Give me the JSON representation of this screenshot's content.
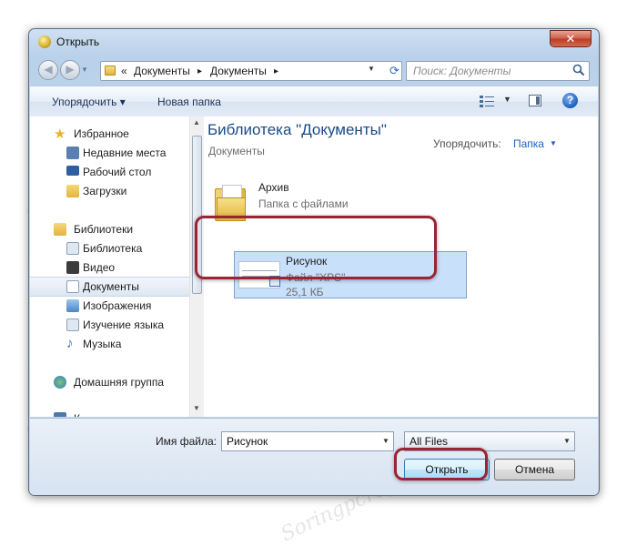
{
  "window": {
    "title": "Открыть",
    "close_glyph": "✕"
  },
  "nav": {
    "back_glyph": "◀",
    "forward_glyph": "▶",
    "breadcrumb": [
      "«",
      "Документы",
      "▸",
      "Документы",
      "▸"
    ],
    "search_placeholder": "Поиск: Документы"
  },
  "toolbar": {
    "organize_label": "Упорядочить ▾",
    "new_folder_label": "Новая папка",
    "help_glyph": "?"
  },
  "sidebar": {
    "items": [
      {
        "label": "Избранное",
        "icon": "star-icon",
        "color": "#e8b32a"
      },
      {
        "label": "Недавние места",
        "icon": "recent-places-icon",
        "color": "#5a7fb3"
      },
      {
        "label": "Рабочий стол",
        "icon": "desktop-icon",
        "color": "#2e5f9e"
      },
      {
        "label": "Загрузки",
        "icon": "downloads-icon",
        "color": "#3d79c9"
      },
      {
        "label": "Библиотеки",
        "icon": "libraries-icon",
        "color": "#e7c35a"
      },
      {
        "label": "Библиотека",
        "icon": "library-icon",
        "color": "#b8c9dc"
      },
      {
        "label": "Видео",
        "icon": "video-icon",
        "color": "#3b3b3b"
      },
      {
        "label": "Документы",
        "icon": "documents-icon",
        "color": "#ffffff"
      },
      {
        "label": "Изображения",
        "icon": "pictures-icon",
        "color": "#4a87c7"
      },
      {
        "label": "Изучение языка",
        "icon": "language-icon",
        "color": "#6a9ad1"
      },
      {
        "label": "Музыка",
        "icon": "music-icon",
        "color": "#2d70c8"
      },
      {
        "label": "Домашняя группа",
        "icon": "homegroup-icon",
        "color": "#3e8e3e"
      },
      {
        "label": "К",
        "icon": "computer-icon",
        "color": "#4d78ab"
      }
    ]
  },
  "content": {
    "library_title": "Библиотека \"Документы\"",
    "library_subtitle": "Документы",
    "arrange_label": "Упорядочить:",
    "arrange_value": "Папка",
    "files": [
      {
        "name": "Архив",
        "meta": "Папка с файлами",
        "size": ""
      },
      {
        "name": "Рисунок",
        "meta": "Файл \"XPS\"",
        "size": "25,1 КБ"
      }
    ]
  },
  "bottom": {
    "filename_label": "Имя файла:",
    "filename_value": "Рисунок",
    "filetype_value": "All Files",
    "open_label": "Открыть",
    "cancel_label": "Отмена"
  },
  "watermark": "Soringpcrepair.com",
  "colors": {
    "highlight": "#9b2335",
    "selection": "#c8e0f9",
    "title_blue": "#1b4a86"
  }
}
